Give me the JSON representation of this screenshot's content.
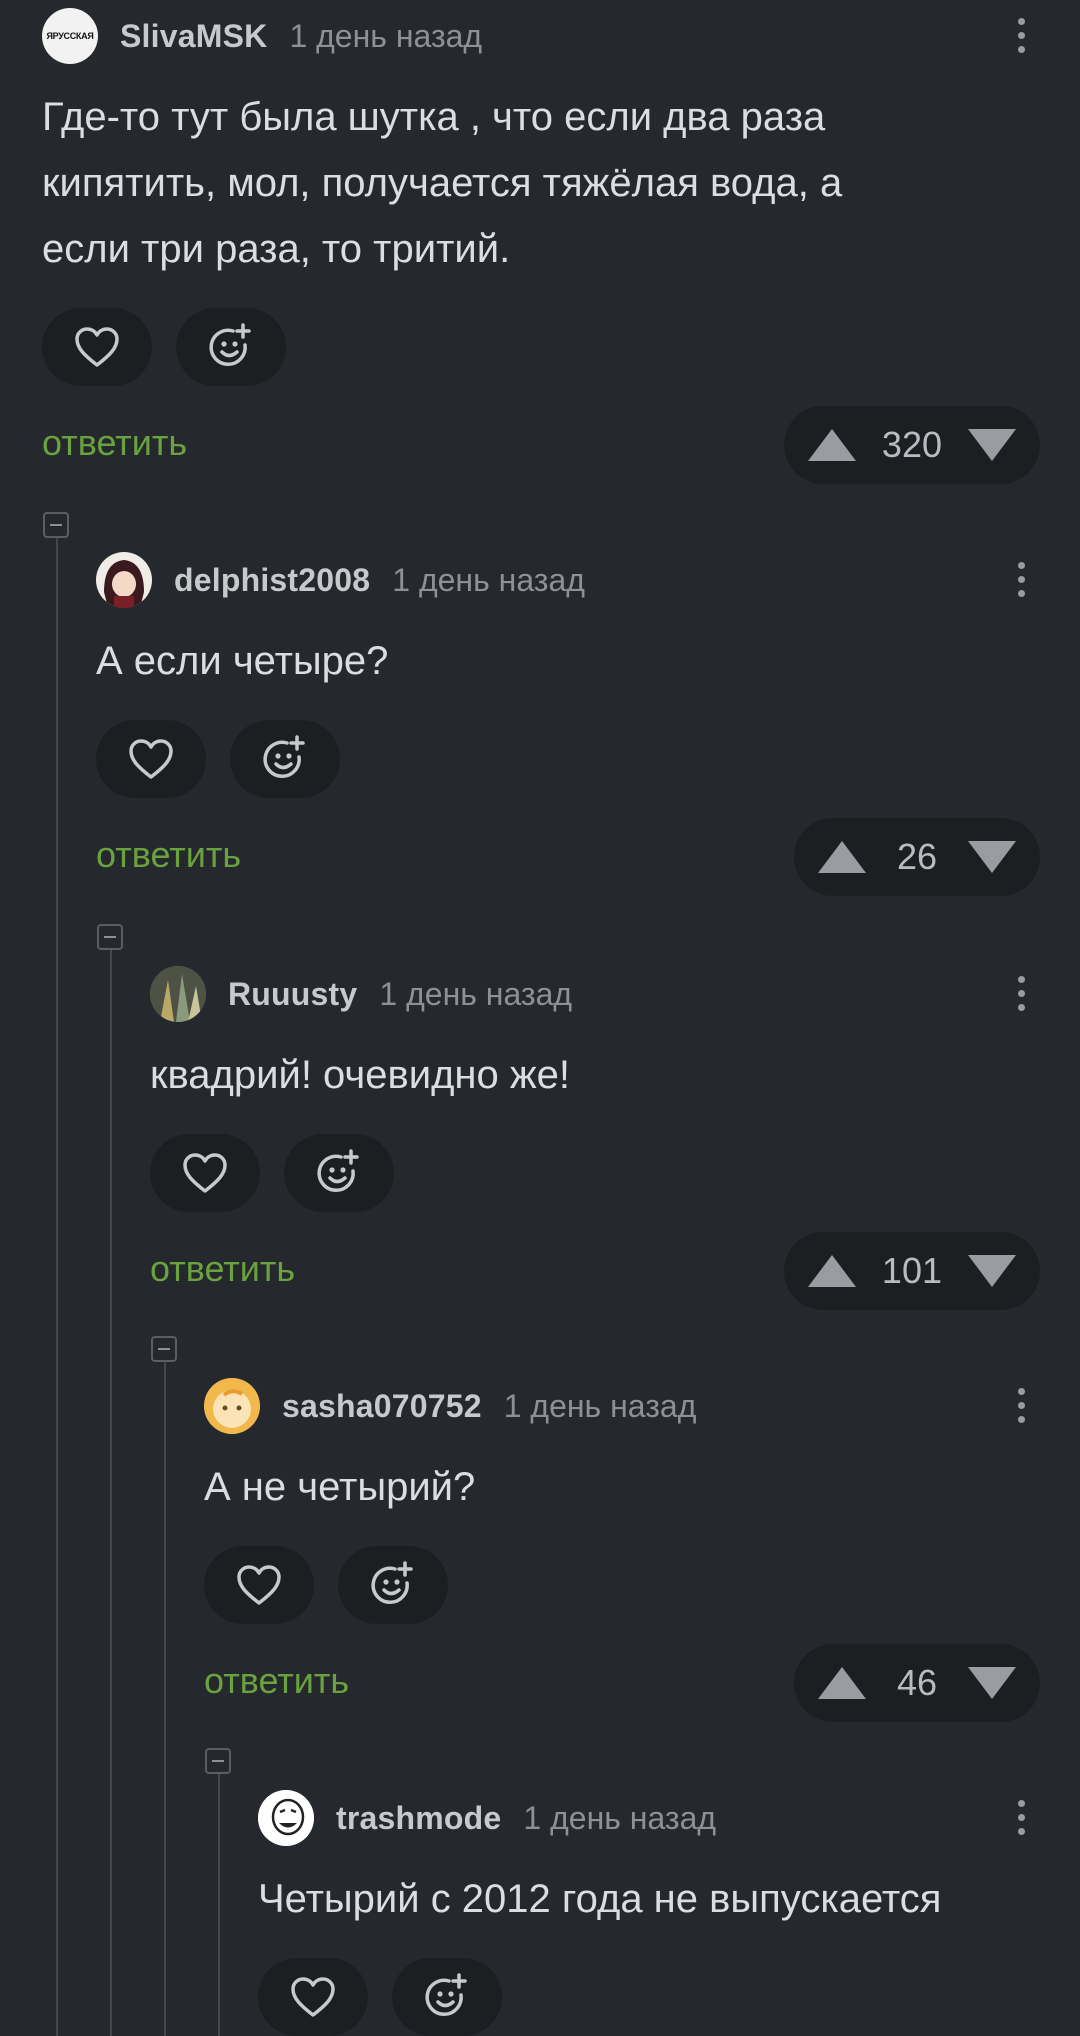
{
  "comments": [
    {
      "username": "SlivaMSK",
      "time": "1 день назад",
      "text": "Где-то тут  была шутка , что если два  раза\nкипятить, мол, получается тяжёлая вода, а\nесли три раза, то тритий.",
      "reply": "ответить",
      "votes": "320",
      "avatar_text": "ЯРУССКАЯ"
    },
    {
      "username": "delphist2008",
      "time": "1 день назад",
      "text": "А если четыре?",
      "reply": "ответить",
      "votes": "26"
    },
    {
      "username": "Ruuusty",
      "time": "1 день назад",
      "text": "квадрий! очевидно же!",
      "reply": "ответить",
      "votes": "101"
    },
    {
      "username": "sasha070752",
      "time": "1 день назад",
      "text": "А не четырий?",
      "reply": "ответить",
      "votes": "46"
    },
    {
      "username": "trashmode",
      "time": "1 день назад",
      "text": "Четырий с 2012 года не выпускается"
    }
  ],
  "colors": {
    "background": "#25282d",
    "reply_link": "#6aa23f",
    "pill": "#1c1e22"
  },
  "icons": [
    "heart-icon",
    "add-reaction-icon",
    "upvote-icon",
    "downvote-icon",
    "more-icon",
    "collapse-icon"
  ]
}
